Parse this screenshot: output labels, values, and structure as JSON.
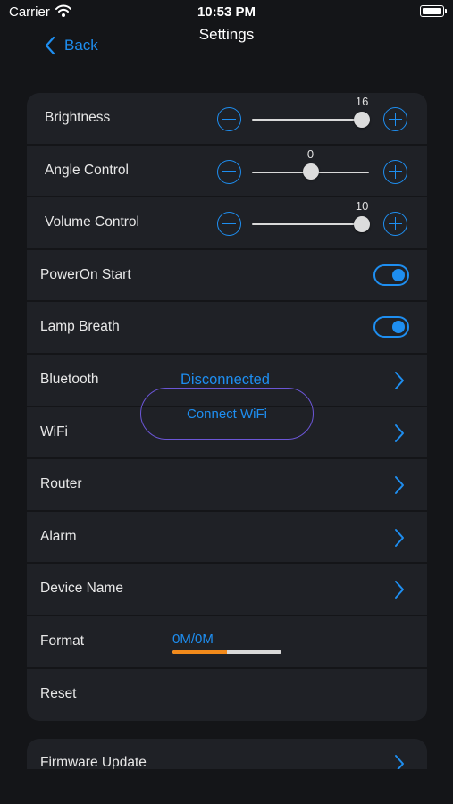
{
  "status_bar": {
    "carrier": "Carrier",
    "time": "10:53 PM"
  },
  "nav": {
    "back_label": "Back",
    "title": "Settings"
  },
  "sliders": [
    {
      "label": "Brightness",
      "value": "16",
      "fraction": 0.94
    },
    {
      "label": "Angle Control",
      "value": "0",
      "fraction": 0.5
    },
    {
      "label": "Volume Control",
      "value": "10",
      "fraction": 0.94
    }
  ],
  "toggles": [
    {
      "label": "PowerOn Start",
      "on": true
    },
    {
      "label": "Lamp Breath",
      "on": true
    }
  ],
  "bluetooth": {
    "label": "Bluetooth",
    "status": "Disconnected"
  },
  "wifi": {
    "label": "WiFi"
  },
  "router": {
    "label": "Router"
  },
  "alarm": {
    "label": "Alarm"
  },
  "device_name": {
    "label": "Device Name"
  },
  "format": {
    "label": "Format",
    "value": "0M/0M",
    "progress": 0.5
  },
  "reset": {
    "label": "Reset"
  },
  "firmware": {
    "label": "Firmware Update"
  },
  "connect_wifi": {
    "label": "Connect WiFi"
  },
  "colors": {
    "accent": "#1e8ef0",
    "progress": "#f28a1b",
    "outline": "#6b56d6",
    "background": "#141518",
    "card": "#1f2126"
  }
}
